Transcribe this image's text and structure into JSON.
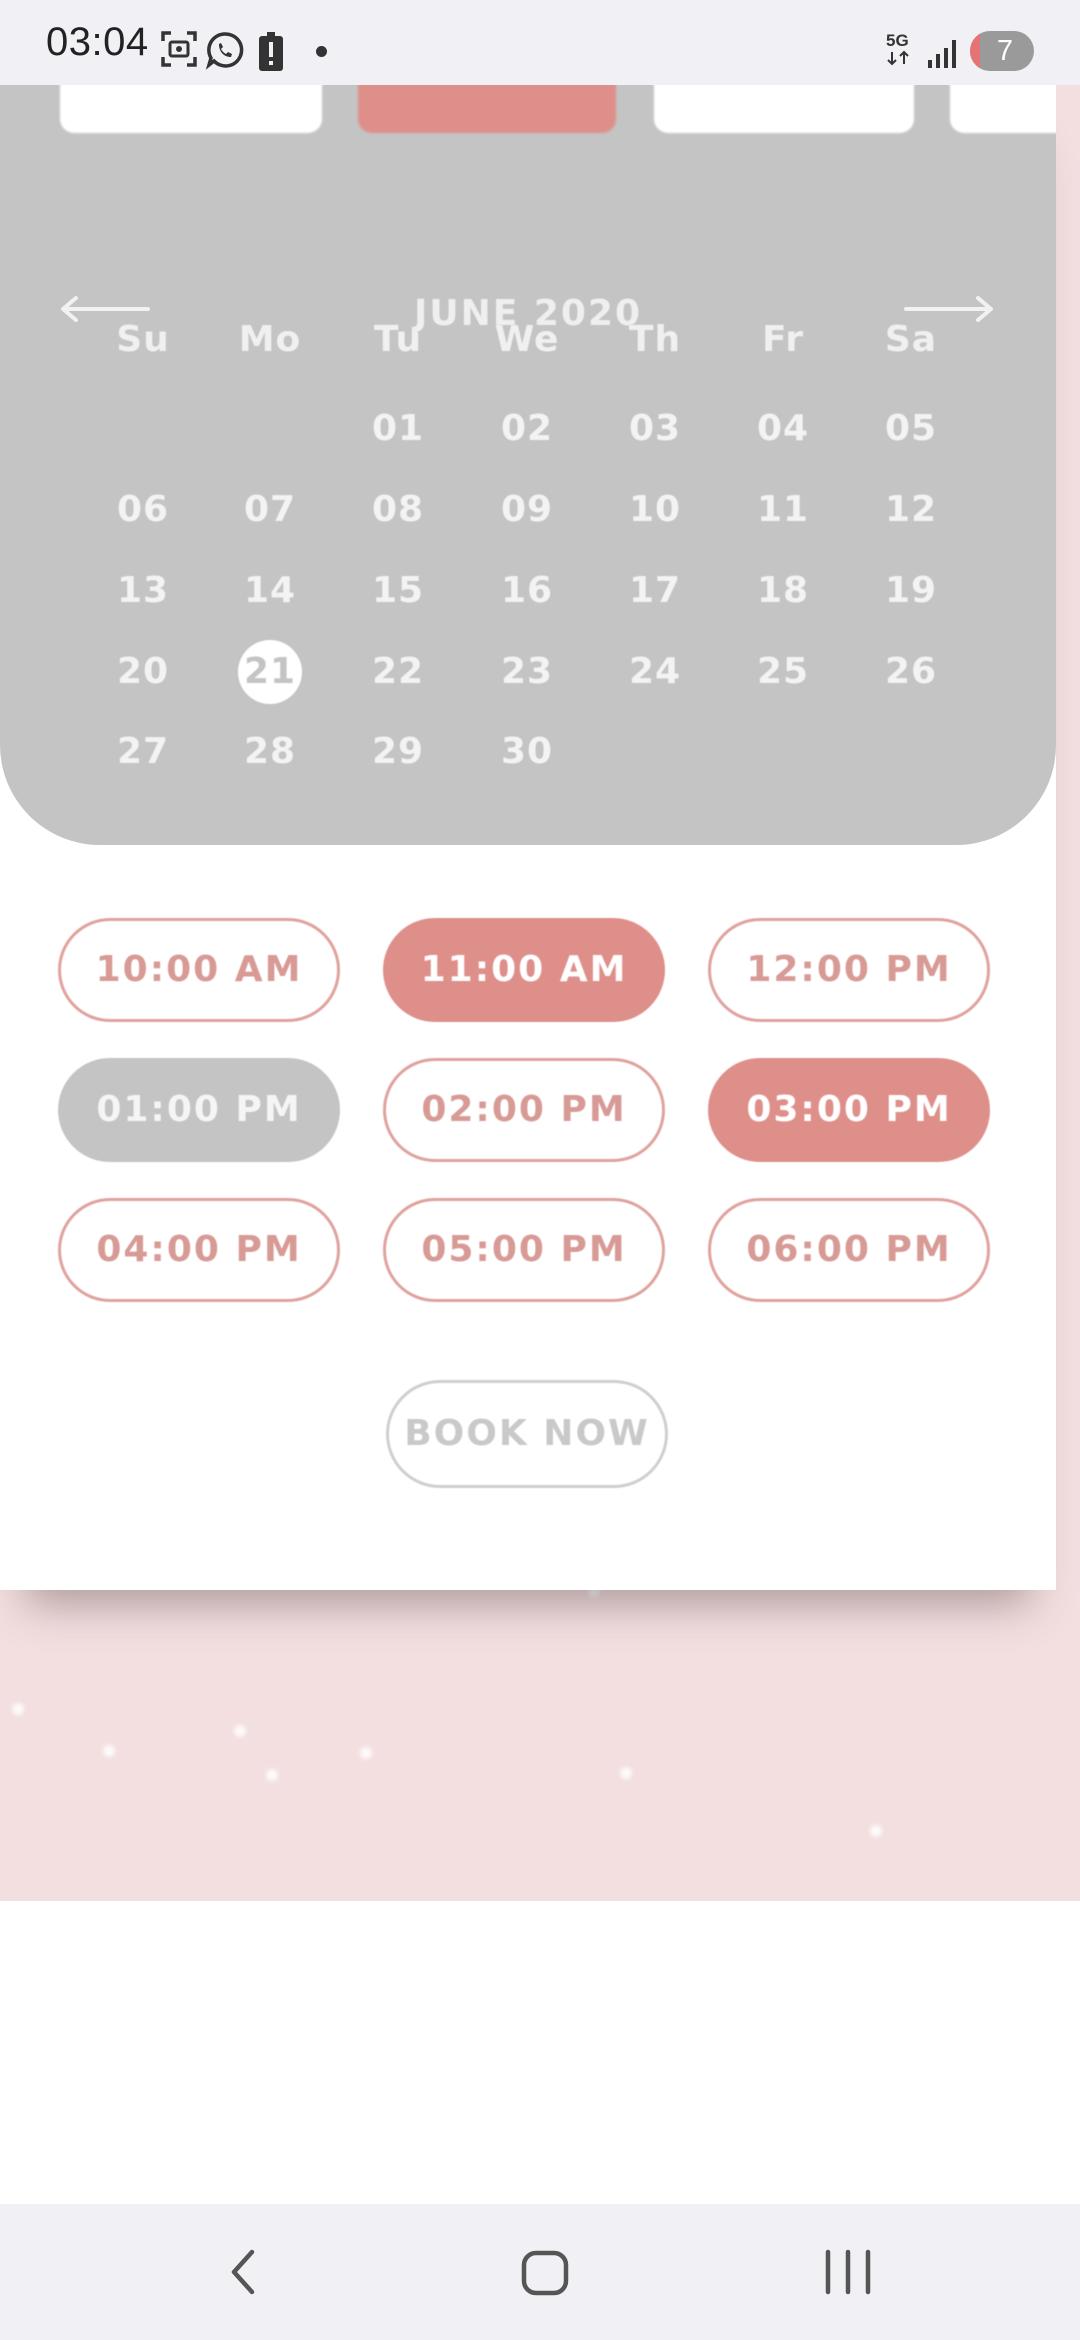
{
  "status_bar": {
    "time": "03:04",
    "network": "5G",
    "notification_count": "7",
    "battery_level": 0.15,
    "icons": [
      "screenshot-icon",
      "whatsapp-icon",
      "battery-alert-icon",
      "notification-dot",
      "signal-icon"
    ]
  },
  "calendar": {
    "month_label": "JUNE 2020",
    "weekdays": [
      "Su",
      "Mo",
      "Tu",
      "We",
      "Th",
      "Fr",
      "Sa"
    ],
    "weeks": [
      [
        "",
        "",
        "01",
        "02",
        "03",
        "04",
        "05"
      ],
      [
        "06",
        "07",
        "08",
        "09",
        "10",
        "11",
        "12"
      ],
      [
        "13",
        "14",
        "15",
        "16",
        "17",
        "18",
        "19"
      ],
      [
        "20",
        "21",
        "22",
        "23",
        "24",
        "25",
        "26"
      ],
      [
        "27",
        "28",
        "29",
        "30",
        "",
        "",
        ""
      ]
    ],
    "selected_day": "21"
  },
  "time_slots": [
    {
      "label": "10:00 AM",
      "state": "available"
    },
    {
      "label": "11:00 AM",
      "state": "selected"
    },
    {
      "label": "12:00 PM",
      "state": "available"
    },
    {
      "label": "01:00 PM",
      "state": "disabled"
    },
    {
      "label": "02:00 PM",
      "state": "available"
    },
    {
      "label": "03:00 PM",
      "state": "selected"
    },
    {
      "label": "04:00 PM",
      "state": "available"
    },
    {
      "label": "05:00 PM",
      "state": "available"
    },
    {
      "label": "06:00 PM",
      "state": "available"
    }
  ],
  "book_button": {
    "label": "BOOK NOW"
  },
  "colors": {
    "accent": "#de8f8a",
    "calendar_bg": "#c4c4c4",
    "page_bg": "#f3dfe0",
    "bar_bg": "#f1f0f5"
  },
  "nav_bar": {
    "icons": [
      "back-icon",
      "home-icon",
      "recents-icon"
    ]
  }
}
